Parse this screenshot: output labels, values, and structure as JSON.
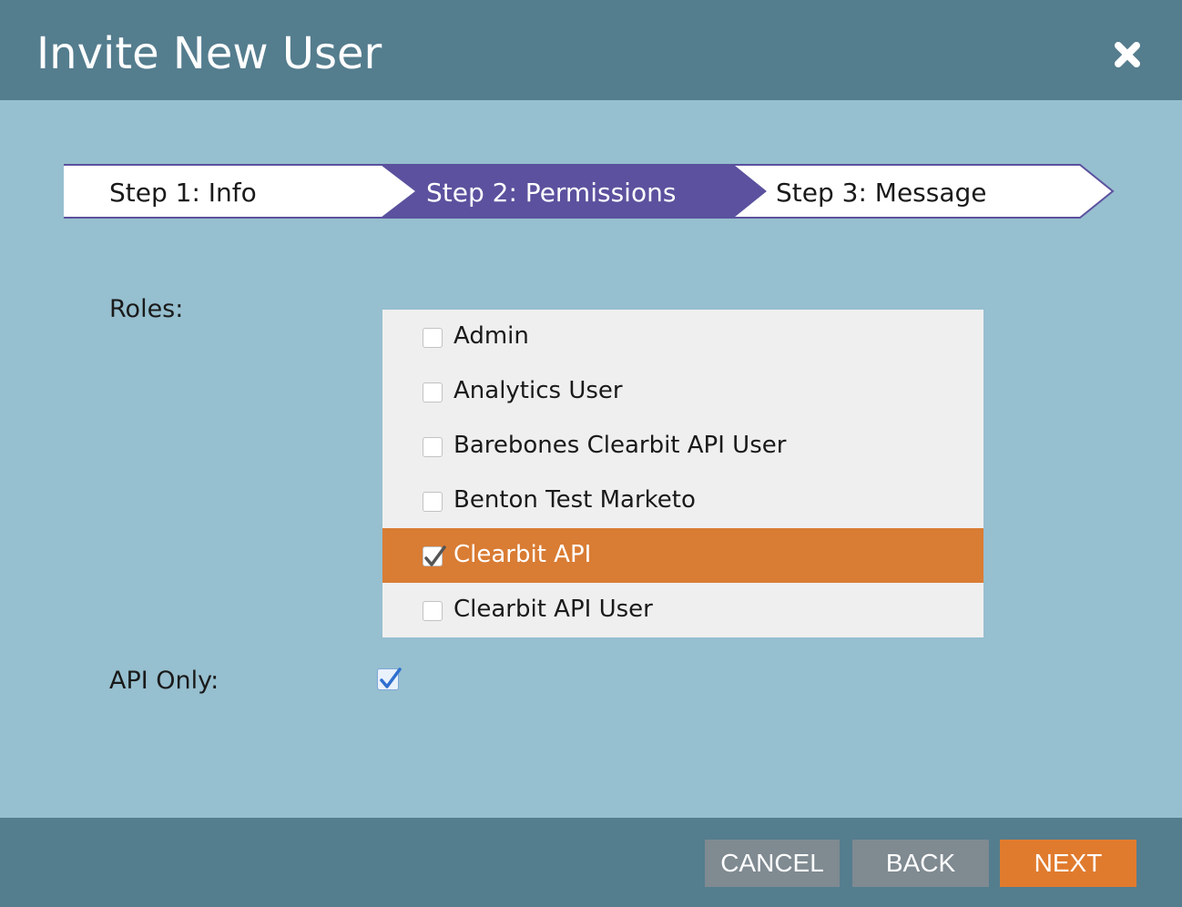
{
  "dialog": {
    "title": "Invite New User",
    "close_icon": "close-icon"
  },
  "steps": [
    {
      "label": "Step 1: Info",
      "active": false
    },
    {
      "label": "Step 2: Permissions",
      "active": true
    },
    {
      "label": "Step 3: Message",
      "active": false
    }
  ],
  "form": {
    "roles_label": "Roles:",
    "api_only_label": "API Only:",
    "api_only_checked": true
  },
  "roles": [
    {
      "label": "Admin",
      "checked": false,
      "selected": false
    },
    {
      "label": "Analytics User",
      "checked": false,
      "selected": false
    },
    {
      "label": "Barebones Clearbit API User",
      "checked": false,
      "selected": false
    },
    {
      "label": "Benton Test Marketo",
      "checked": false,
      "selected": false
    },
    {
      "label": "Clearbit API",
      "checked": true,
      "selected": true
    },
    {
      "label": "Clearbit API User",
      "checked": false,
      "selected": false
    }
  ],
  "buttons": {
    "cancel": "CANCEL",
    "back": "BACK",
    "next": "NEXT"
  },
  "colors": {
    "header": "#547d8e",
    "body": "#96bfcf",
    "active_step": "#5b519e",
    "selected_row": "#d97c34",
    "next_button": "#e07b2e",
    "secondary_button": "#7f8a91"
  }
}
